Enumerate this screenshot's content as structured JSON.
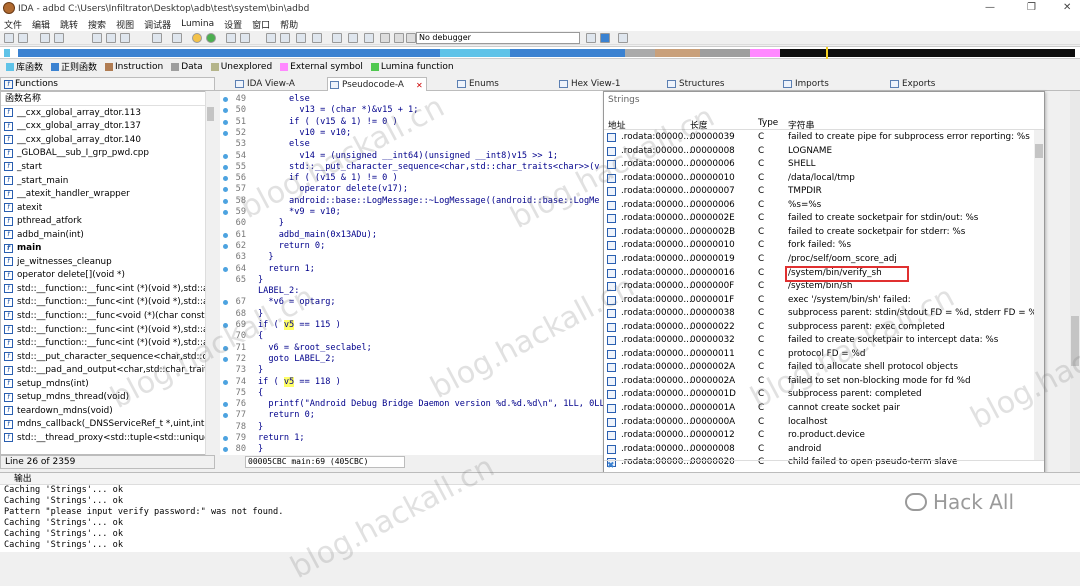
{
  "title": "IDA - adbd C:\\Users\\Infiltrator\\Desktop\\adb\\test\\system\\bin\\adbd",
  "menu": [
    "文件",
    "编辑",
    "跳转",
    "搜索",
    "视图",
    "调试器",
    "Lumina",
    "设置",
    "窗口",
    "帮助"
  ],
  "debugger_select": "No debugger",
  "legend": [
    {
      "label": "库函数",
      "color": "#5fc3e8"
    },
    {
      "label": "正则函数",
      "color": "#3b82d1"
    },
    {
      "label": "Instruction",
      "color": "#b07c52"
    },
    {
      "label": "Data",
      "color": "#9e9e9e"
    },
    {
      "label": "Unexplored",
      "color": "#b5b58a"
    },
    {
      "label": "External symbol",
      "color": "#ff88ff"
    },
    {
      "label": "Lumina function",
      "color": "#50c850"
    }
  ],
  "functions_panel": {
    "title": "Functions",
    "column": "函数名称",
    "items": [
      "__cxx_global_array_dtor.113",
      "__cxx_global_array_dtor.137",
      "__cxx_global_array_dtor.140",
      "_GLOBAL__sub_I_grp_pwd.cpp",
      "_start",
      "_start_main",
      "__atexit_handler_wrapper",
      "atexit",
      "pthread_atfork",
      "adbd_main(int)",
      "main",
      "je_witnesses_cleanup",
      "operator delete[](void *)",
      "std::__function::__func<int (*)(void *),std::alloc",
      "std::__function::__func<int (*)(void *),std::alloc",
      "std::__function::__func<void (*)(char const*),st",
      "std::__function::__func<int (*)(void *),std::alloc",
      "std::__function::__func<int (*)(void *),std::alloc",
      "std::__put_character_sequence<char,std::char",
      "std::__pad_and_output<char,std::char_traits<c",
      "setup_mdns(int)",
      "setup_mdns_thread(void)",
      "teardown_mdns(void)",
      "mdns_callback(_DNSServiceRef_t *,uint,int,cha",
      "std::__thread_proxy<std::tuple<std::unique_p"
    ],
    "selected": "main",
    "status": "Line 26 of 2359"
  },
  "tabs": [
    {
      "label": "IDA View-A"
    },
    {
      "label": "Pseudocode-A"
    },
    {
      "label": "Hex View-1"
    },
    {
      "label": "Structures"
    },
    {
      "label": "Enums"
    },
    {
      "label": "Imports"
    },
    {
      "label": "Exports"
    }
  ],
  "code_lines": [
    {
      "n": "49",
      "t": "      else"
    },
    {
      "n": "50",
      "t": "        v13 = (char *)&v15 + 1;"
    },
    {
      "n": "51",
      "t": "      if ( (v15 & 1) != 0 )"
    },
    {
      "n": "52",
      "t": "        v10 = v10;"
    },
    {
      "n": "53",
      "t": "      else"
    },
    {
      "n": "54",
      "t": "        v14 = (unsigned __int64)(unsigned __int8)v15 >> 1;"
    },
    {
      "n": "55",
      "t": "      std::__put_character_sequence<char,std::char_traits<char>>(v"
    },
    {
      "n": "56",
      "t": "      if ( (v15 & 1) != 0 )"
    },
    {
      "n": "57",
      "t": "        operator delete(v17);"
    },
    {
      "n": "58",
      "t": "      android::base::LogMessage::~LogMessage((android::base::LogMe"
    },
    {
      "n": "59",
      "t": "      *v9 = v10;"
    },
    {
      "n": "60",
      "t": "    }"
    },
    {
      "n": "61",
      "t": "    adbd_main(0x13ADu);"
    },
    {
      "n": "62",
      "t": "    return 0;"
    },
    {
      "n": "63",
      "t": "  }"
    },
    {
      "n": "64",
      "t": "  return 1;"
    },
    {
      "n": "65",
      "t": "}"
    },
    {
      "n": "",
      "t": "LABEL_2:"
    },
    {
      "n": "67",
      "t": "  *v6 = optarg;"
    },
    {
      "n": "68",
      "t": "}"
    },
    {
      "n": "69",
      "t": "if ( v5 == 115 )"
    },
    {
      "n": "70",
      "t": "{"
    },
    {
      "n": "71",
      "t": "  v6 = &root_seclabel;"
    },
    {
      "n": "72",
      "t": "  goto LABEL_2;"
    },
    {
      "n": "73",
      "t": "}"
    },
    {
      "n": "74",
      "t": "if ( v5 == 118 )"
    },
    {
      "n": "75",
      "t": "{"
    },
    {
      "n": "76",
      "t": "  printf(\"Android Debug Bridge Daemon version %d.%d.%d\\n\", 1LL, 0LL,"
    },
    {
      "n": "77",
      "t": "  return 0;"
    },
    {
      "n": "78",
      "t": "}"
    },
    {
      "n": "79",
      "t": "return 1;"
    },
    {
      "n": "80",
      "t": "}"
    }
  ],
  "code_status": "00005CBC main:69 (405CBC)",
  "strings_panel": {
    "title": "Strings",
    "columns": [
      "地址",
      "长度",
      "Type",
      "字符串"
    ],
    "rows": [
      {
        "addr": ".rodata:00000...",
        "len": "00000039",
        "type": "C",
        "str": "failed to create pipe for subprocess error reporting: %s"
      },
      {
        "addr": ".rodata:00000...",
        "len": "00000008",
        "type": "C",
        "str": "LOGNAME"
      },
      {
        "addr": ".rodata:00000...",
        "len": "00000006",
        "type": "C",
        "str": "SHELL"
      },
      {
        "addr": ".rodata:00000...",
        "len": "00000010",
        "type": "C",
        "str": "/data/local/tmp"
      },
      {
        "addr": ".rodata:00000...",
        "len": "00000007",
        "type": "C",
        "str": "TMPDIR"
      },
      {
        "addr": ".rodata:00000...",
        "len": "00000006",
        "type": "C",
        "str": "%s=%s"
      },
      {
        "addr": ".rodata:00000...",
        "len": "0000002E",
        "type": "C",
        "str": "failed to create socketpair for stdin/out: %s"
      },
      {
        "addr": ".rodata:00000...",
        "len": "0000002B",
        "type": "C",
        "str": "failed to create socketpair for stderr: %s"
      },
      {
        "addr": ".rodata:00000...",
        "len": "00000010",
        "type": "C",
        "str": "fork failed: %s"
      },
      {
        "addr": ".rodata:00000...",
        "len": "00000019",
        "type": "C",
        "str": "/proc/self/oom_score_adj"
      },
      {
        "addr": ".rodata:00000...",
        "len": "00000016",
        "type": "C",
        "str": "/system/bin/verify_sh"
      },
      {
        "addr": ".rodata:00000...",
        "len": "0000000F",
        "type": "C",
        "str": "/system/bin/sh"
      },
      {
        "addr": ".rodata:00000...",
        "len": "0000001F",
        "type": "C",
        "str": "exec '/system/bin/sh' failed:"
      },
      {
        "addr": ".rodata:00000...",
        "len": "00000038",
        "type": "C",
        "str": "subprocess parent: stdin/stdout FD = %d, stderr FD = %d"
      },
      {
        "addr": ".rodata:00000...",
        "len": "00000022",
        "type": "C",
        "str": "subprocess parent: exec completed"
      },
      {
        "addr": ".rodata:00000...",
        "len": "00000032",
        "type": "C",
        "str": "failed to create socketpair to intercept data: %s"
      },
      {
        "addr": ".rodata:00000...",
        "len": "00000011",
        "type": "C",
        "str": "protocol FD = %d"
      },
      {
        "addr": ".rodata:00000...",
        "len": "0000002A",
        "type": "C",
        "str": "failed to allocate shell protocol objects"
      },
      {
        "addr": ".rodata:00000...",
        "len": "0000002A",
        "type": "C",
        "str": "failed to set non-blocking mode for fd %d"
      },
      {
        "addr": ".rodata:00000...",
        "len": "0000001D",
        "type": "C",
        "str": "subprocess parent: completed"
      },
      {
        "addr": ".rodata:00000...",
        "len": "0000001A",
        "type": "C",
        "str": "cannot create socket pair"
      },
      {
        "addr": ".rodata:00000...",
        "len": "0000000A",
        "type": "C",
        "str": "localhost"
      },
      {
        "addr": ".rodata:00000...",
        "len": "00000012",
        "type": "C",
        "str": "ro.product.device"
      },
      {
        "addr": ".rodata:00000...",
        "len": "00000008",
        "type": "C",
        "str": "android"
      },
      {
        "addr": ".rodata:00000...",
        "len": "00000020",
        "type": "C",
        "str": "child failed to open pseudo-term slave"
      }
    ]
  },
  "output_panel": {
    "title": "输出",
    "lines": [
      "Caching 'Strings'... ok",
      "Caching 'Strings'... ok",
      "Pattern \"please input verify password:\" was not found.",
      "Caching 'Strings'... ok",
      "Caching 'Strings'... ok",
      "Caching 'Strings'... ok"
    ]
  },
  "watermark": {
    "text": "blog.hackall.cn",
    "logo": "Hack All"
  }
}
